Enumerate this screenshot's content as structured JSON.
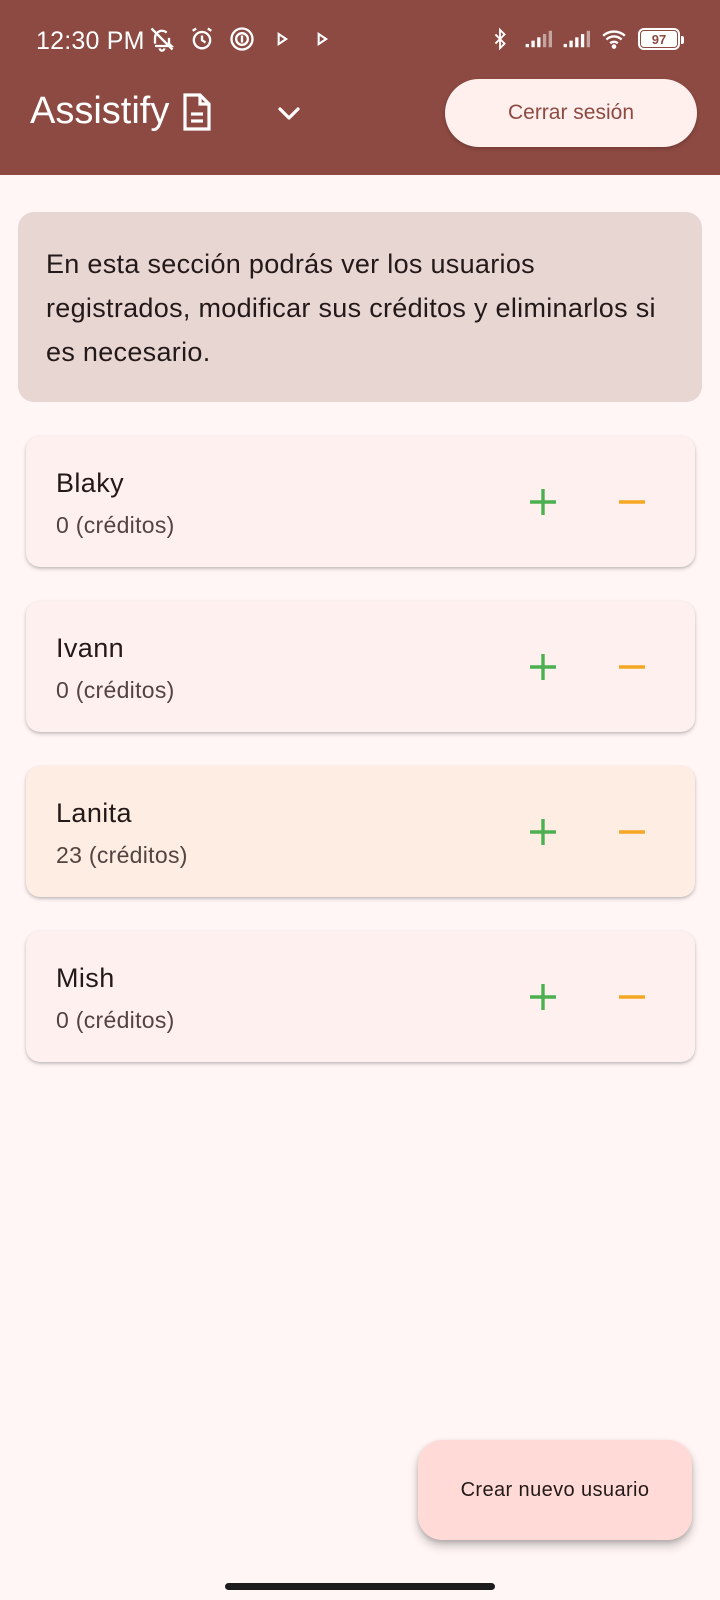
{
  "status_bar": {
    "time": "12:30 PM",
    "battery": "97",
    "left_icons": [
      "mute-icon",
      "alarm-icon",
      "fingerprint-icon",
      "play-icon",
      "play-icon"
    ],
    "right_icons": [
      "bluetooth-icon",
      "signal-icon",
      "signal-icon",
      "wifi-icon",
      "battery-icon"
    ]
  },
  "appbar": {
    "title": "Assistify",
    "logout_label": "Cerrar sesión"
  },
  "info": {
    "text": "En esta sección podrás ver los usuarios registrados, modificar sus créditos y eliminarlos si es necesario."
  },
  "users": [
    {
      "name": "Blaky",
      "credits": "0 (créditos)"
    },
    {
      "name": "Ivann",
      "credits": "0 (créditos)"
    },
    {
      "name": "Lanita",
      "credits": "23 (créditos)"
    },
    {
      "name": "Mish",
      "credits": "0 (créditos)"
    }
  ],
  "fab": {
    "label": "Crear nuevo usuario"
  },
  "colors": {
    "primary": "#8d4a42",
    "plus": "#4caf50",
    "minus": "#f5a623",
    "highlight_card": "#feede3"
  }
}
